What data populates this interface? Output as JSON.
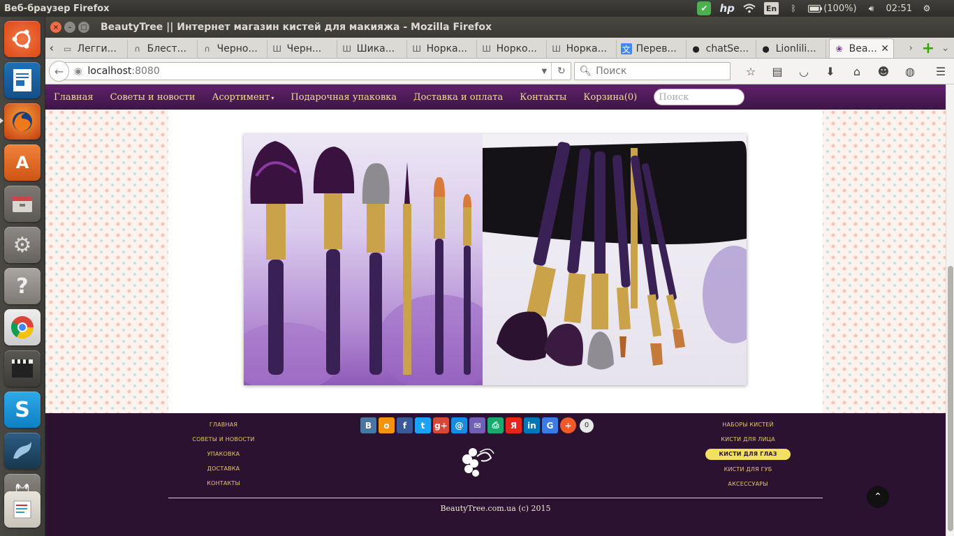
{
  "panel": {
    "app_title": "Веб-браузер Firefox",
    "lang": "En",
    "battery": "(100%)",
    "clock": "02:51"
  },
  "window": {
    "title": "BeautyTree || Интернет магазин кистей для макияжа - Mozilla Firefox"
  },
  "tabs": [
    {
      "label": "Легги...",
      "icon": "page-icon"
    },
    {
      "label": "Блест...",
      "icon": "n-icon"
    },
    {
      "label": "Черно...",
      "icon": "n-icon"
    },
    {
      "label": "Черн...",
      "icon": "sh-icon"
    },
    {
      "label": "Шика...",
      "icon": "sh-icon"
    },
    {
      "label": "Норка...",
      "icon": "sh-icon"
    },
    {
      "label": "Норко...",
      "icon": "sh-icon"
    },
    {
      "label": "Норка...",
      "icon": "sh-icon"
    },
    {
      "label": "Перев...",
      "icon": "translate-icon"
    },
    {
      "label": "chatSe...",
      "icon": "github-icon"
    },
    {
      "label": "Lionlili...",
      "icon": "github-icon"
    }
  ],
  "active_tab": {
    "label": "Bea...",
    "icon": "beautytree-icon"
  },
  "address": {
    "host": "localhost",
    "port": ":8080"
  },
  "search": {
    "placeholder": "Поиск"
  },
  "site": {
    "nav": [
      {
        "label": "Главная"
      },
      {
        "label": "Советы и новости"
      },
      {
        "label": "Асортимент",
        "has_caret": true
      },
      {
        "label": "Подарочная упаковка"
      },
      {
        "label": "Доставка и оплата"
      },
      {
        "label": "Контакты"
      },
      {
        "label": "Корзина(0)"
      }
    ],
    "search_placeholder": "Поиск",
    "footer_left": [
      "ГЛАВНАЯ",
      "СОВЕТЫ И НОВОСТИ",
      "УПАКОВКА",
      "ДОСТАВКА",
      "КОНТАКТЫ"
    ],
    "footer_right": [
      "НАБОРЫ КИСТЕЙ",
      "КИСТИ ДЛЯ ЛИЦА",
      "КИСТИ ДЛЯ ГЛАЗ",
      "КИСТИ ДЛЯ ГУБ",
      "АКСЕССУАРЫ"
    ],
    "share_count": "0",
    "copyright": "BeautyTree.com.ua (c) 2015"
  },
  "colors": {
    "nav_bg": "#4b1a55",
    "nav_text": "#f3dd9c",
    "footer_bg": "#2b1231",
    "footer_link": "#e7c86a",
    "active_pill": "#f2e060"
  }
}
